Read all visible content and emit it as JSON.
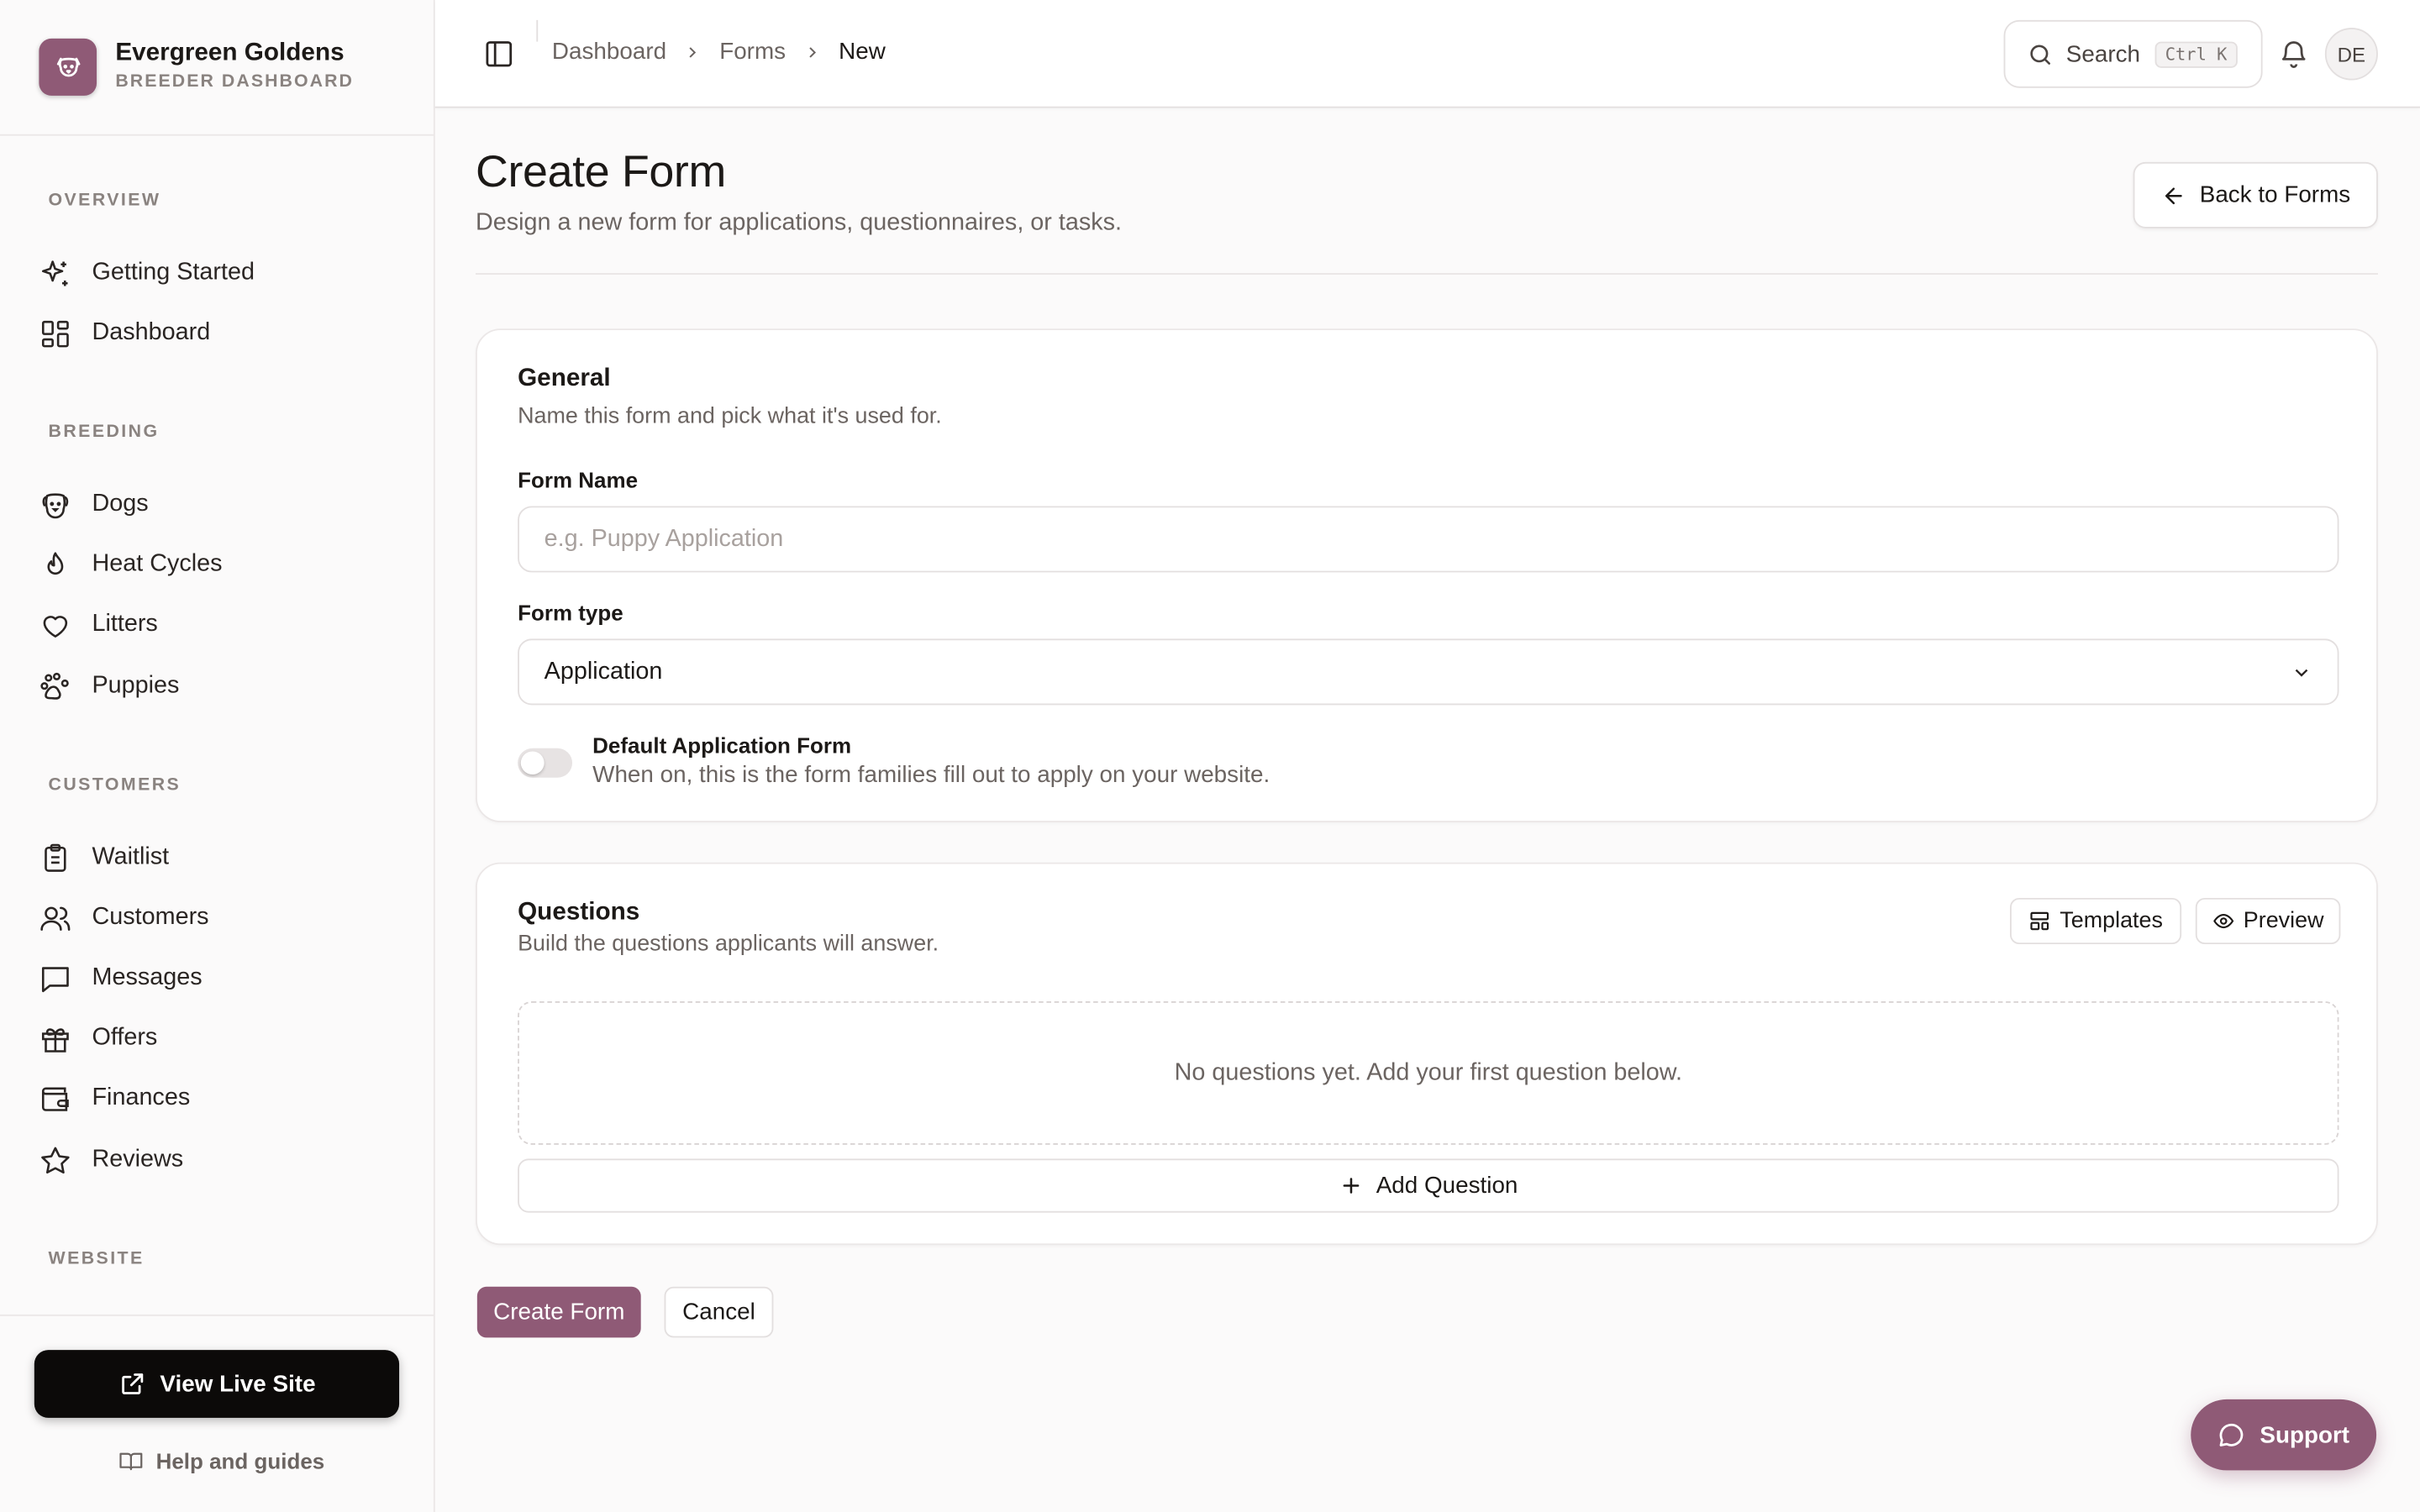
{
  "brand": {
    "name": "Evergreen Goldens",
    "subtitle": "BREEDER DASHBOARD",
    "accent": "#8f5a76"
  },
  "sidebar": {
    "sections": [
      {
        "label": "OVERVIEW",
        "items": [
          {
            "label": "Getting Started",
            "icon": "sparkles-icon"
          },
          {
            "label": "Dashboard",
            "icon": "grid-icon"
          }
        ]
      },
      {
        "label": "BREEDING",
        "items": [
          {
            "label": "Dogs",
            "icon": "dog-icon"
          },
          {
            "label": "Heat Cycles",
            "icon": "flame-icon"
          },
          {
            "label": "Litters",
            "icon": "heart-icon"
          },
          {
            "label": "Puppies",
            "icon": "paw-icon"
          }
        ]
      },
      {
        "label": "CUSTOMERS",
        "items": [
          {
            "label": "Waitlist",
            "icon": "clipboard-list-icon"
          },
          {
            "label": "Customers",
            "icon": "users-icon"
          },
          {
            "label": "Messages",
            "icon": "message-square-icon"
          },
          {
            "label": "Offers",
            "icon": "gift-icon"
          },
          {
            "label": "Finances",
            "icon": "wallet-icon"
          },
          {
            "label": "Reviews",
            "icon": "star-icon"
          }
        ]
      },
      {
        "label": "WEBSITE",
        "items": []
      }
    ],
    "view_live_site": "View Live Site",
    "help": "Help and guides"
  },
  "topbar": {
    "breadcrumbs": [
      "Dashboard",
      "Forms",
      "New"
    ],
    "search_label": "Search",
    "search_shortcut": "Ctrl K",
    "avatar_initials": "DE"
  },
  "page": {
    "title": "Create Form",
    "subtitle": "Design a new form for applications, questionnaires, or tasks.",
    "back_button": "Back to Forms"
  },
  "general": {
    "title": "General",
    "subtitle": "Name this form and pick what it's used for.",
    "form_name_label": "Form Name",
    "form_name_placeholder": "e.g. Puppy Application",
    "form_name_value": "",
    "form_type_label": "Form type",
    "form_type_value": "Application",
    "default_toggle_title": "Default Application Form",
    "default_toggle_desc": "When on, this is the form families fill out to apply on your website.",
    "default_toggle_on": false
  },
  "questions": {
    "title": "Questions",
    "subtitle": "Build the questions applicants will answer.",
    "templates_button": "Templates",
    "preview_button": "Preview",
    "empty_text": "No questions yet. Add your first question below.",
    "add_button": "Add Question"
  },
  "actions": {
    "create": "Create Form",
    "cancel": "Cancel"
  },
  "support_button": "Support"
}
